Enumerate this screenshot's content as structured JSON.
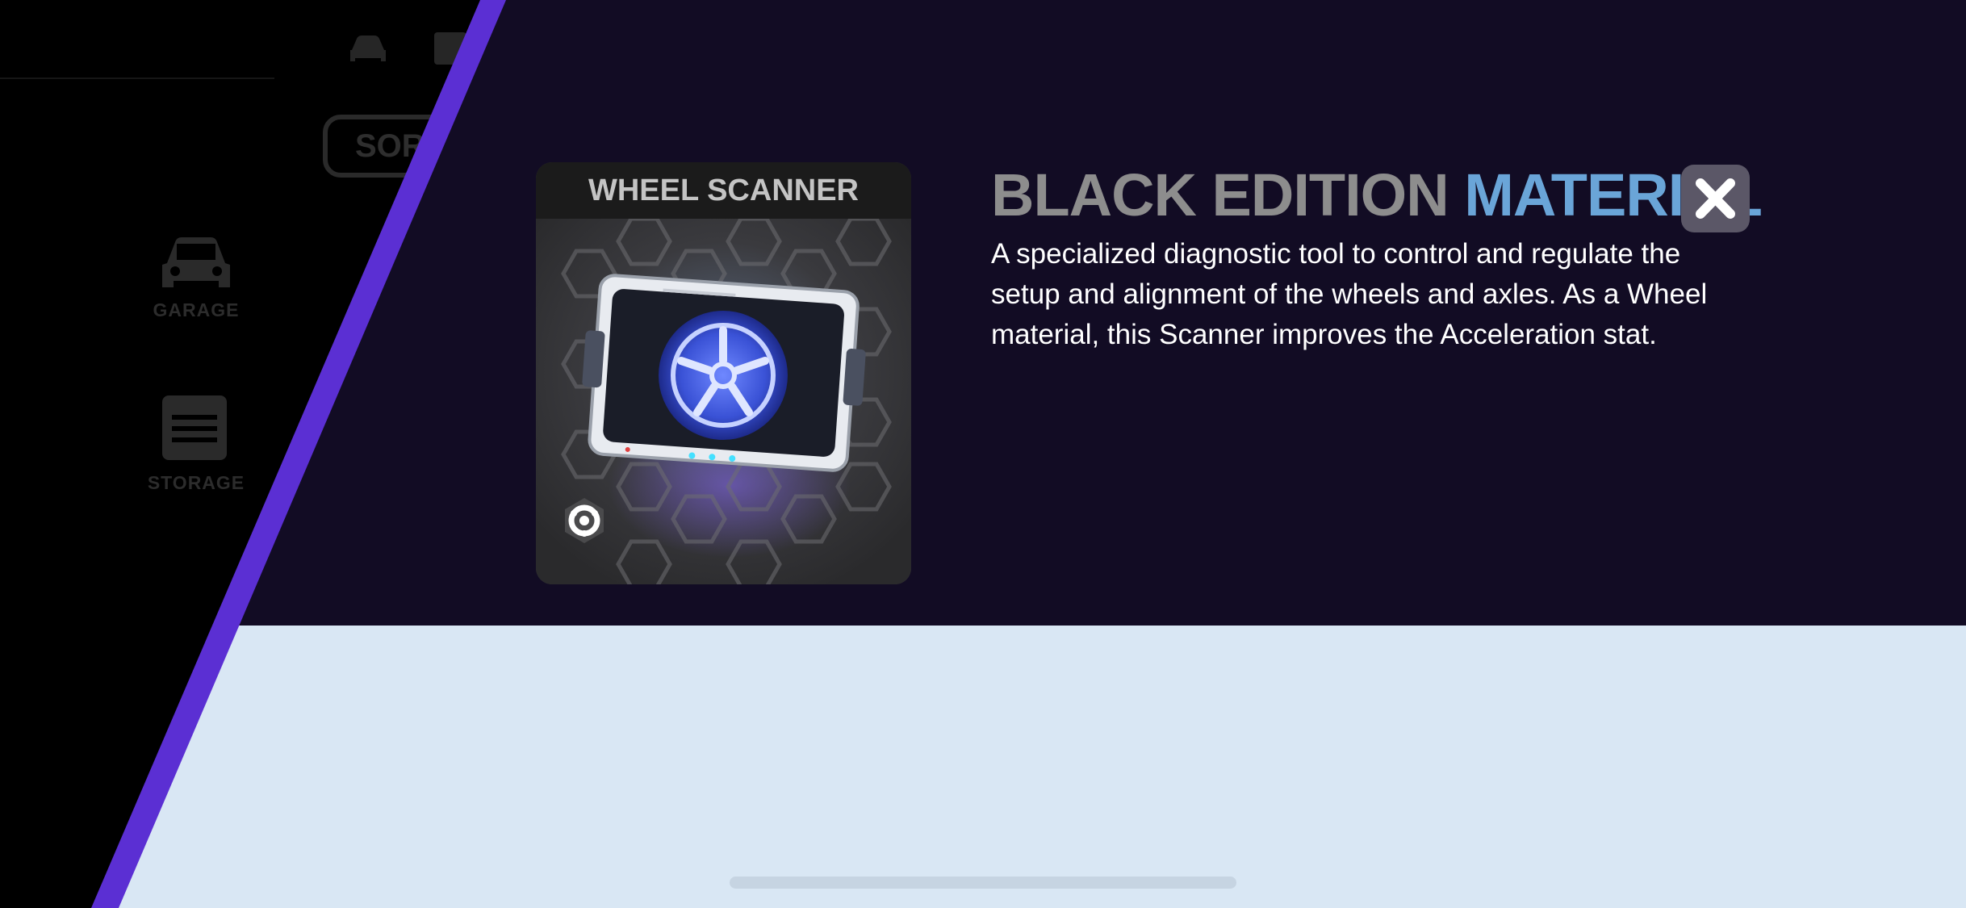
{
  "sidebar": {
    "sort_label": "SORT",
    "items": [
      {
        "label": "GARAGE",
        "icon": "car-icon"
      },
      {
        "label": "STORAGE",
        "icon": "storage-icon"
      }
    ]
  },
  "card": {
    "name": "WHEEL SCANNER",
    "image_icon": "wheel-scanner-icon",
    "category_icon": "wheel-category-icon"
  },
  "detail": {
    "title_prefix": "BLACK EDITION",
    "title_accent": "MATERIAL",
    "description": "A specialized diagnostic tool to control and regulate the setup and alignment of the wheels and axles. As a Wheel material, this Scanner improves the Acceleration stat."
  },
  "close": {
    "icon": "close-icon"
  },
  "colors": {
    "panel": "#120c24",
    "lower_panel": "#d9e7f4",
    "accent_stripe": "#5b2fd3",
    "title_gray": "#8d8d8d",
    "title_accent": "#6aa5d8",
    "wheel_glow": "#4a63e8"
  }
}
